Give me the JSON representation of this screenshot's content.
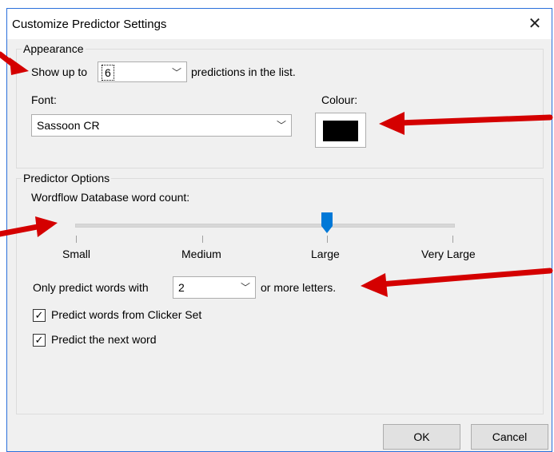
{
  "window": {
    "title": "Customize Predictor Settings"
  },
  "appearance": {
    "legend": "Appearance",
    "show_prefix": "Show up to",
    "show_value": "6",
    "show_suffix": "predictions in the list.",
    "font_label": "Font:",
    "font_value": "Sassoon CR",
    "colour_label": "Colour:",
    "colour_value": "#000000"
  },
  "predictor": {
    "legend": "Predictor Options",
    "slider_label": "Wordflow Database word count:",
    "slider_ticks": [
      "Small",
      "Medium",
      "Large",
      "Very Large"
    ],
    "slider_selected": "Large",
    "min_prefix": "Only predict words with",
    "min_value": "2",
    "min_suffix": "or more letters.",
    "check_clicker_label": "Predict words from Clicker Set",
    "check_clicker_checked": true,
    "check_next_label": "Predict the next word",
    "check_next_checked": true
  },
  "buttons": {
    "ok": "OK",
    "cancel": "Cancel"
  },
  "icons": {
    "close": "close-icon",
    "chevron": "chevron-down-icon",
    "check": "check-icon",
    "annotation": "red-arrow-icon"
  },
  "colors": {
    "accent": "#0078d7",
    "annotation": "#e00000"
  }
}
